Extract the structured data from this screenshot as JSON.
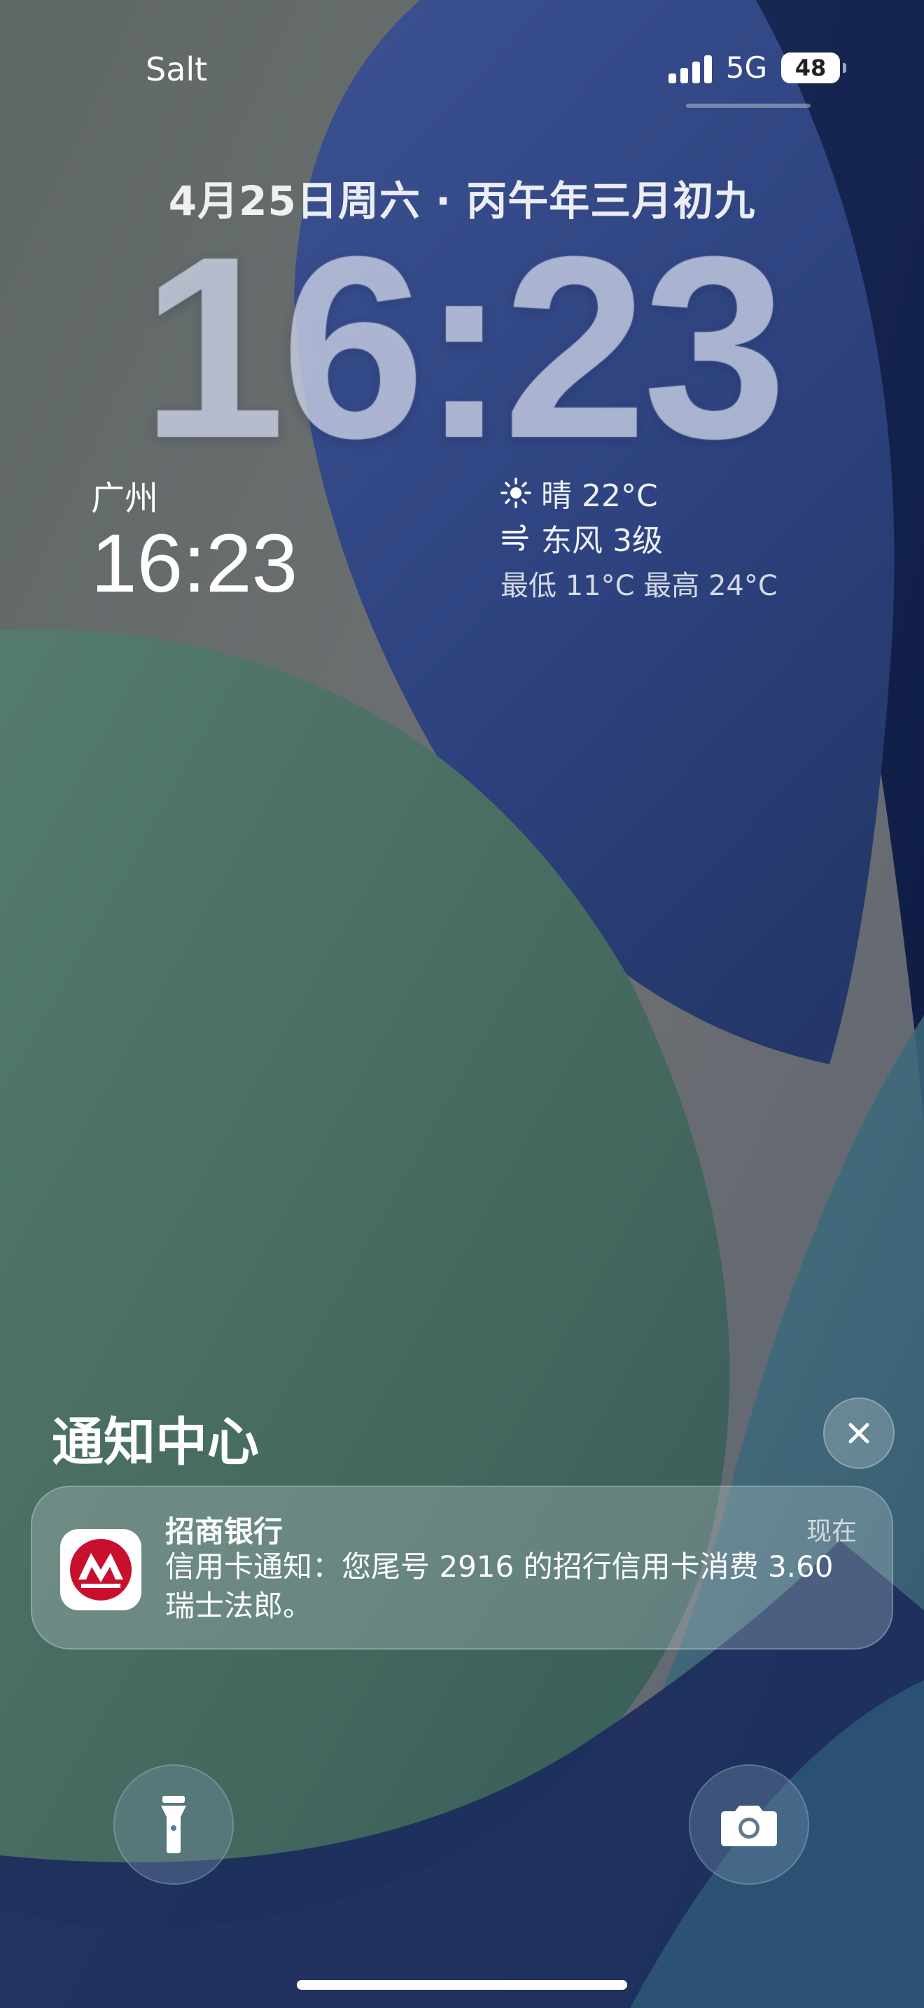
{
  "status_bar": {
    "carrier": "Salt",
    "network": "5G",
    "battery_level": "48"
  },
  "lock_screen": {
    "date": "4月25日周六 · 丙午年三月初九",
    "time": "16:23"
  },
  "widgets": {
    "world_clock": {
      "city": "广州",
      "time": "16:23"
    },
    "weather": {
      "condition": "晴 22°C",
      "wind": "东风 3级",
      "range": "最低 11°C 最高 24°C"
    }
  },
  "notification_center": {
    "title": "通知中心",
    "notifications": [
      {
        "app": "招商银行",
        "time": "现在",
        "message": "信用卡通知：您尾号 2916 的招行信用卡消费 3.60 瑞士法郎。"
      }
    ]
  },
  "quick_actions": {
    "left": "flashlight-icon",
    "right": "camera-icon"
  },
  "colors": {
    "bank_red": "#c8102e",
    "wallpaper_blue": "#2c3f78",
    "wallpaper_green": "#4b6c62",
    "wallpaper_gray": "#6b6f72"
  }
}
